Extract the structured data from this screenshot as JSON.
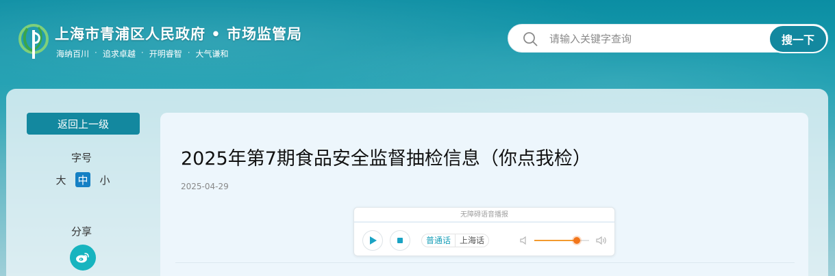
{
  "header": {
    "site_title": "上海市青浦区人民政府 • 市场监管局",
    "slogans": [
      "海纳百川",
      "追求卓越",
      "开明睿智",
      "大气谦和"
    ],
    "slogan_separator": "·",
    "logo_icon": "qingpu-logo-icon"
  },
  "search": {
    "placeholder": "请输入关键字查询",
    "button_label": "搜一下",
    "icon": "search-icon"
  },
  "sidebar": {
    "back_label": "返回上一级",
    "font_size_label": "字号",
    "font_sizes": [
      "大",
      "中",
      "小"
    ],
    "font_size_selected": "中",
    "share_label": "分享",
    "share_icon": "weibo-icon"
  },
  "article": {
    "title": "2025年第7期食品安全监督抽检信息（你点我检）",
    "date": "2025-04-29"
  },
  "player": {
    "header": "无障碍语音播报",
    "play_icon": "play-icon",
    "stop_icon": "stop-icon",
    "languages": [
      "普通话",
      "上海话"
    ],
    "language_selected": "普通话",
    "volume_level": 0.78
  },
  "colors": {
    "accent": "#13889f",
    "font_size_active": "#1580c4",
    "share_button": "#17b4bf",
    "volume": "#f2751a"
  }
}
